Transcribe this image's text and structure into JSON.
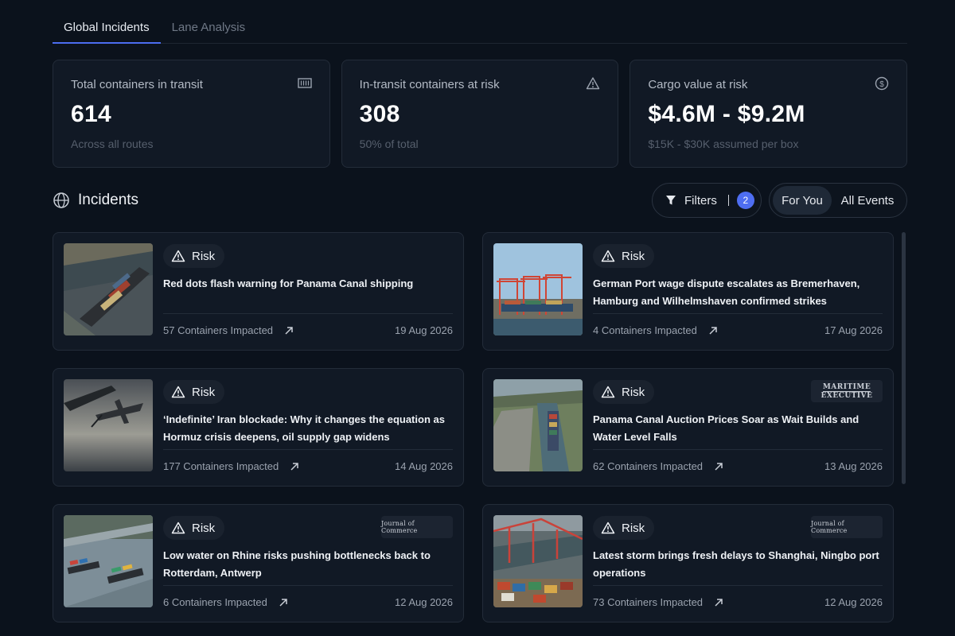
{
  "tabs": [
    {
      "label": "Global Incidents",
      "active": true
    },
    {
      "label": "Lane Analysis",
      "active": false
    }
  ],
  "stats": [
    {
      "label": "Total containers in transit",
      "value": "614",
      "sub": "Across all routes",
      "icon": "container-icon"
    },
    {
      "label": "In-transit containers at risk",
      "value": "308",
      "sub": "50% of total",
      "icon": "warning-icon"
    },
    {
      "label": "Cargo value at risk",
      "value": "$4.6M - $9.2M",
      "sub": "$15K - $30K assumed per box",
      "icon": "dollar-circle-icon"
    }
  ],
  "incidents_header": {
    "title": "Incidents",
    "filters_label": "Filters",
    "filters_count": "2",
    "segments": [
      "For You",
      "All Events"
    ],
    "active_segment": "For You"
  },
  "incidents": [
    {
      "tag": "Risk",
      "headline": "Red dots flash warning for Panama Canal shipping",
      "impact": "57 Containers Impacted",
      "date": "19 Aug 2026",
      "source": ""
    },
    {
      "tag": "Risk",
      "headline": "German Port wage dispute escalates as Bremerhaven, Hamburg and Wilhelmshaven confirmed strikes",
      "impact": "4 Containers Impacted",
      "date": "17 Aug 2026",
      "source": ""
    },
    {
      "tag": "Risk",
      "headline": "‘Indefinite’ Iran blockade: Why it changes the equation as Hormuz crisis deepens, oil supply gap widens",
      "impact": "177 Containers Impacted",
      "date": "14 Aug 2026",
      "source": ""
    },
    {
      "tag": "Risk",
      "headline": "Panama Canal Auction Prices Soar as Wait Builds and Water Level Falls",
      "impact": "62 Containers Impacted",
      "date": "13 Aug 2026",
      "source": "The Maritime Executive"
    },
    {
      "tag": "Risk",
      "headline": "Low water on Rhine risks pushing bottlenecks back to Rotterdam, Antwerp",
      "impact": "6 Containers Impacted",
      "date": "12 Aug 2026",
      "source": "Journal of Commerce"
    },
    {
      "tag": "Risk",
      "headline": "Latest storm brings fresh delays to Shanghai, Ningbo port operations",
      "impact": "73 Containers Impacted",
      "date": "12 Aug 2026",
      "source": "Journal of Commerce"
    }
  ],
  "colors": {
    "background": "#0b121c",
    "card": "#111925",
    "accent": "#4e6ef2",
    "muted_text": "#9aa2ae"
  }
}
